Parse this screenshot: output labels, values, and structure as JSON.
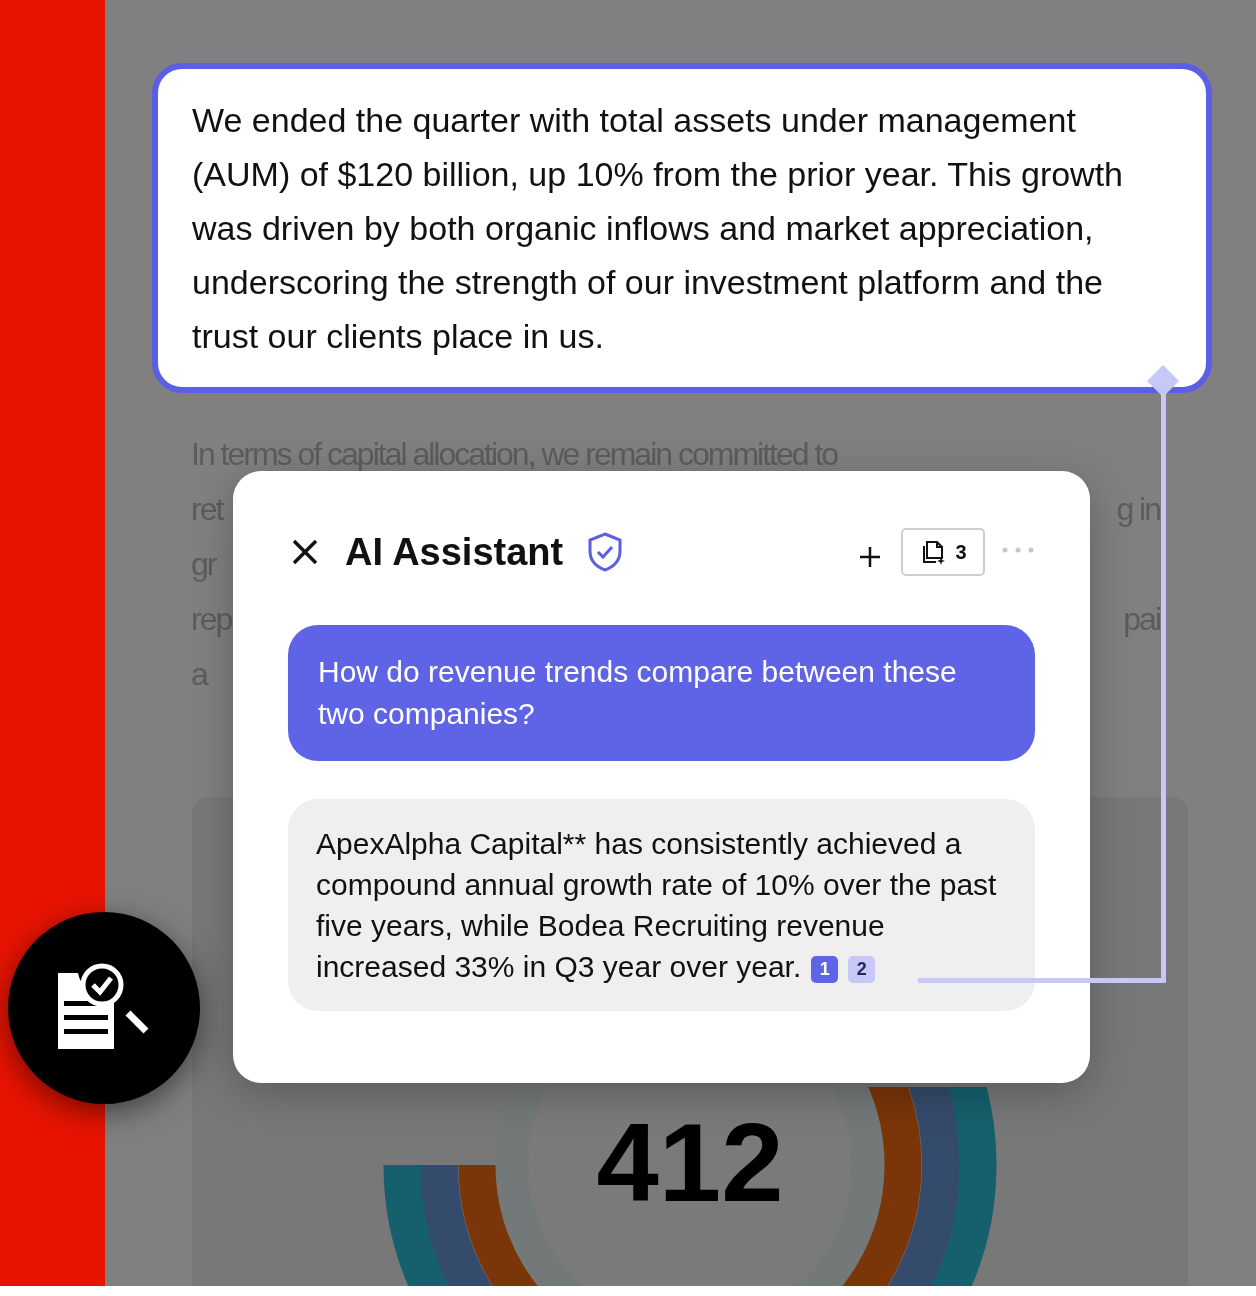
{
  "document": {
    "highlighted_quote": "We ended the quarter with total assets under management (AUM) of $120 billion, up 10% from the prior year. This growth was driven by both organic inflows and market appreciation, underscoring the strength of our investment platform and the trust our clients place in us.",
    "paragraph_lines": [
      {
        "left": "In terms of capital allocation, we remain committed to"
      },
      {
        "left": "ret",
        "right": "g in"
      },
      {
        "left": "gr"
      },
      {
        "left": "rep",
        "right": "pai"
      },
      {
        "left": "a"
      }
    ],
    "chart_center_value": "412"
  },
  "assistant": {
    "title": "AI Assistant",
    "source_count": "3",
    "messages": [
      {
        "kind": "question",
        "text": "How do revenue trends compare between these two companies?"
      },
      {
        "kind": "answer",
        "text": "ApexAlpha Capital** has consistently achieved a compound annual growth rate of 10% over the past five years, while Bodea Recruiting revenue increased 33% in Q3 year over year.",
        "citations": [
          {
            "label": "1",
            "selected": true
          },
          {
            "label": "2",
            "selected": false
          }
        ]
      }
    ]
  }
}
